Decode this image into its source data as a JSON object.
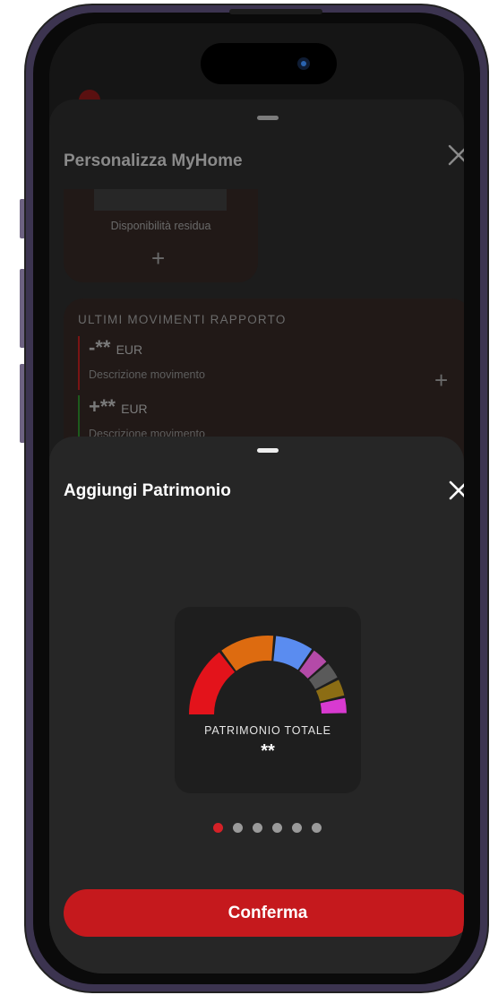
{
  "background_sheet": {
    "title": "Personalizza MyHome",
    "card_residual": {
      "label": "Disponibilità residua",
      "add_icon": "plus-icon"
    },
    "card_movements": {
      "title": "ULTIMI MOVIMENTI RAPPORTO",
      "movements": [
        {
          "amount": "-**",
          "currency": "EUR",
          "description": "Descrizione movimento",
          "color": "#7a1414"
        },
        {
          "amount": "+**",
          "currency": "EUR",
          "description": "Descrizione movimento",
          "color": "#1d5a1d"
        }
      ],
      "add_icon": "plus-icon"
    },
    "close_icon": "close-icon"
  },
  "front_sheet": {
    "title": "Aggiungi Patrimonio",
    "close_icon": "close-icon",
    "widget": {
      "label": "PATRIMONIO TOTALE",
      "value": "**",
      "gauge_segment_colors": [
        "#e3131b",
        "#dd6b10",
        "#5a8cf0",
        "#b44aa8",
        "#5a5a5a",
        "#8c6d14",
        "#d83ad0"
      ]
    },
    "pagination": {
      "total": 6,
      "current": 1
    },
    "confirm_label": "Conferma"
  },
  "colors": {
    "accent": "#c5191d",
    "sheet": "#262626",
    "background": "#121212"
  }
}
